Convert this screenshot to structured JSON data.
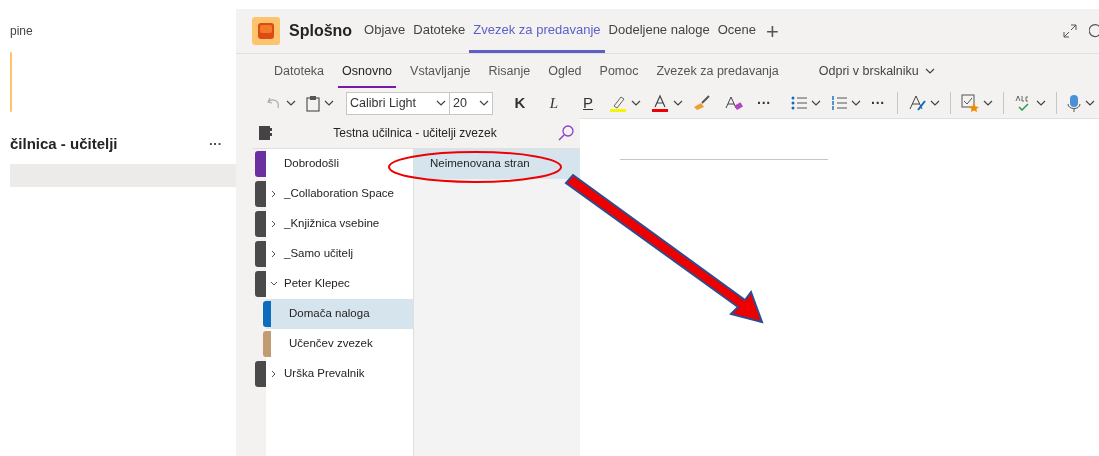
{
  "left_panel": {
    "team_fragment": "pine",
    "class_title": "čilnica - učitelji",
    "more": "···"
  },
  "header": {
    "title": "Splošno",
    "tabs": [
      {
        "label": "Objave",
        "selected": false
      },
      {
        "label": "Datoteke",
        "selected": false
      },
      {
        "label": "Zvezek za predavanje",
        "selected": true
      },
      {
        "label": "Dodeljene naloge",
        "selected": false
      },
      {
        "label": "Ocene",
        "selected": false
      }
    ],
    "add": "+"
  },
  "ribbon": {
    "tabs": [
      {
        "label": "Datoteka",
        "selected": false
      },
      {
        "label": "Osnovno",
        "selected": true
      },
      {
        "label": "Vstavljanje",
        "selected": false
      },
      {
        "label": "Risanje",
        "selected": false
      },
      {
        "label": "Ogled",
        "selected": false
      },
      {
        "label": "Pomoc",
        "selected": false
      },
      {
        "label": "Zvezek za predavanja",
        "selected": false
      }
    ],
    "open_in_browser": "Odpri v brskalniku",
    "font": "Calibri Light",
    "size": "20",
    "bold": "K",
    "italic": "L",
    "underline": "P",
    "more": "···"
  },
  "notebook": {
    "title": "Testna učilnica - učitelji zvezek",
    "sections": [
      {
        "kind": "section",
        "label": "Dobrodošli",
        "color": "#6b2fa0",
        "selected": false
      },
      {
        "kind": "group",
        "label": "_Collaboration Space",
        "color": "#4a4a4a",
        "expanded": false,
        "selected": false
      },
      {
        "kind": "group",
        "label": "_Knjižnica vsebine",
        "color": "#4a4a4a",
        "expanded": false,
        "selected": false
      },
      {
        "kind": "group",
        "label": "_Samo učitelj",
        "color": "#4a4a4a",
        "expanded": false,
        "selected": false
      },
      {
        "kind": "group",
        "label": "Peter Klepec",
        "color": "#4a4a4a",
        "expanded": true,
        "selected": false,
        "children": [
          {
            "kind": "section",
            "label": "Domača naloga",
            "color": "#0f6cbd",
            "selected": true
          },
          {
            "kind": "section",
            "label": "Učenčev zvezek",
            "color": "#c19c72",
            "selected": false
          }
        ]
      },
      {
        "kind": "group",
        "label": "Urška Prevalnik",
        "color": "#4a4a4a",
        "expanded": false,
        "selected": false
      }
    ],
    "pages": [
      {
        "title": "Neimenovana stran",
        "selected": true
      }
    ]
  }
}
